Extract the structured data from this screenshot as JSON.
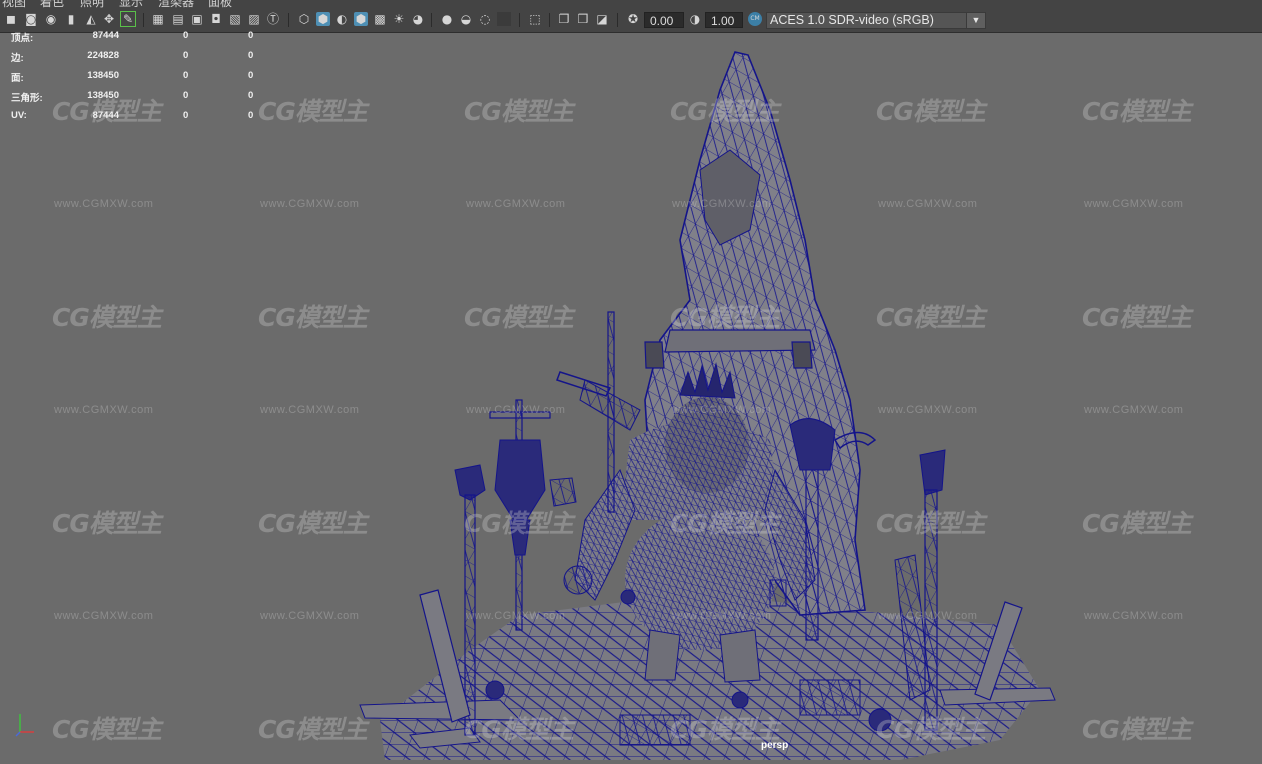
{
  "menu": {
    "items": [
      "视图",
      "着色",
      "照明",
      "显示",
      "渲染器",
      "面板"
    ]
  },
  "toolbar": {
    "exposure": "0.00",
    "gamma": "1.00",
    "color_space": "ACES 1.0 SDR-video (sRGB)",
    "icons": [
      "select-camera-icon",
      "camera-attributes-icon",
      "bookmark-icon",
      "image-plane-icon",
      "2d-pan-zoom-icon",
      "grease-pencil-icon",
      "grid-icon",
      "film-gate-icon",
      "resolution-gate-icon",
      "gate-mask-icon",
      "field-chart-icon",
      "safe-action-icon",
      "safe-title-icon",
      "wireframe-icon",
      "smooth-shade-icon",
      "use-default-material-icon",
      "wireframe-on-shaded-icon",
      "xray-icon",
      "use-all-lights-icon",
      "shadows-icon",
      "screen-space-ao-icon",
      "motion-blur-icon",
      "anti-aliasing-icon",
      "depth-of-field-icon",
      "isolate-select-icon",
      "xray-joints-icon",
      "xray-active-icon",
      "backface-culling-icon",
      "exposure-icon",
      "gamma-icon",
      "color-management-icon"
    ]
  },
  "hud": {
    "rows": [
      {
        "label": "顶点:",
        "v1": "87444",
        "v2": "0",
        "v3": "0"
      },
      {
        "label": "边:",
        "v1": "224828",
        "v2": "0",
        "v3": "0"
      },
      {
        "label": "面:",
        "v1": "138450",
        "v2": "0",
        "v3": "0"
      },
      {
        "label": "三角形:",
        "v1": "138450",
        "v2": "0",
        "v3": "0"
      },
      {
        "label": "UV:",
        "v1": "87444",
        "v2": "0",
        "v3": "0"
      }
    ]
  },
  "watermark": {
    "logo": "CG模型主",
    "url": "www.CGMXW.com"
  },
  "viewport": {
    "camera_label": "persp",
    "background": "#6b6b6b",
    "wire_color": "#14148a"
  }
}
